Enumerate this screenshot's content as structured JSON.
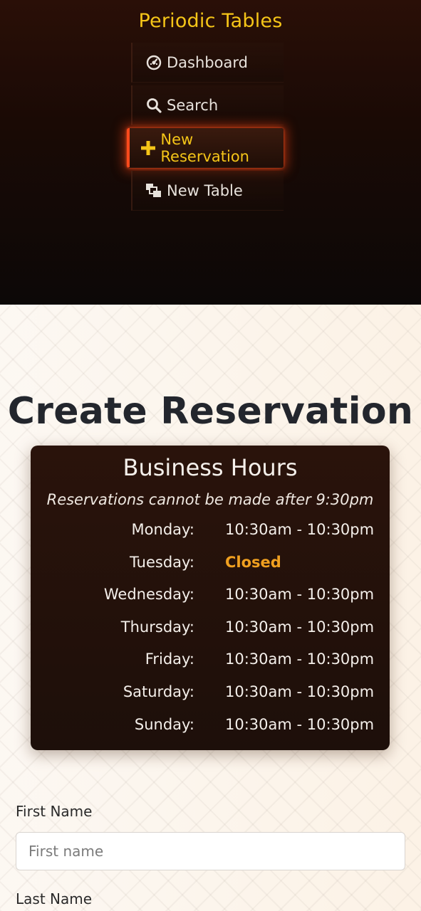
{
  "nav": {
    "brand": "Periodic Tables",
    "items": [
      {
        "label": "Dashboard",
        "icon": "dashboard-icon",
        "active": false
      },
      {
        "label": "Search",
        "icon": "search-icon",
        "active": false
      },
      {
        "label": "New Reservation",
        "icon": "plus-icon",
        "active": true
      },
      {
        "label": "New Table",
        "icon": "layers-icon",
        "active": false
      }
    ],
    "colors": {
      "brand": "#f5c518",
      "active_glow": "#ff4a1c",
      "background": "#1a0a05"
    }
  },
  "main": {
    "title": "Create Reservation",
    "business_hours": {
      "title": "Business Hours",
      "note": "Reservations cannot be made after 9:30pm",
      "rows": [
        {
          "day": "Monday:",
          "time": "10:30am - 10:30pm"
        },
        {
          "day": "Tuesday:",
          "time": "Closed"
        },
        {
          "day": "Wednesday:",
          "time": "10:30am - 10:30pm"
        },
        {
          "day": "Thursday:",
          "time": "10:30am - 10:30pm"
        },
        {
          "day": "Friday:",
          "time": "10:30am - 10:30pm"
        },
        {
          "day": "Saturday:",
          "time": "10:30am - 10:30pm"
        },
        {
          "day": "Sunday:",
          "time": "10:30am - 10:30pm"
        }
      ],
      "closed_color": "#f0a020"
    },
    "form": {
      "first_name_label": "First Name",
      "first_name_placeholder": "First name",
      "first_name_value": "",
      "last_name_label": "Last Name"
    }
  }
}
